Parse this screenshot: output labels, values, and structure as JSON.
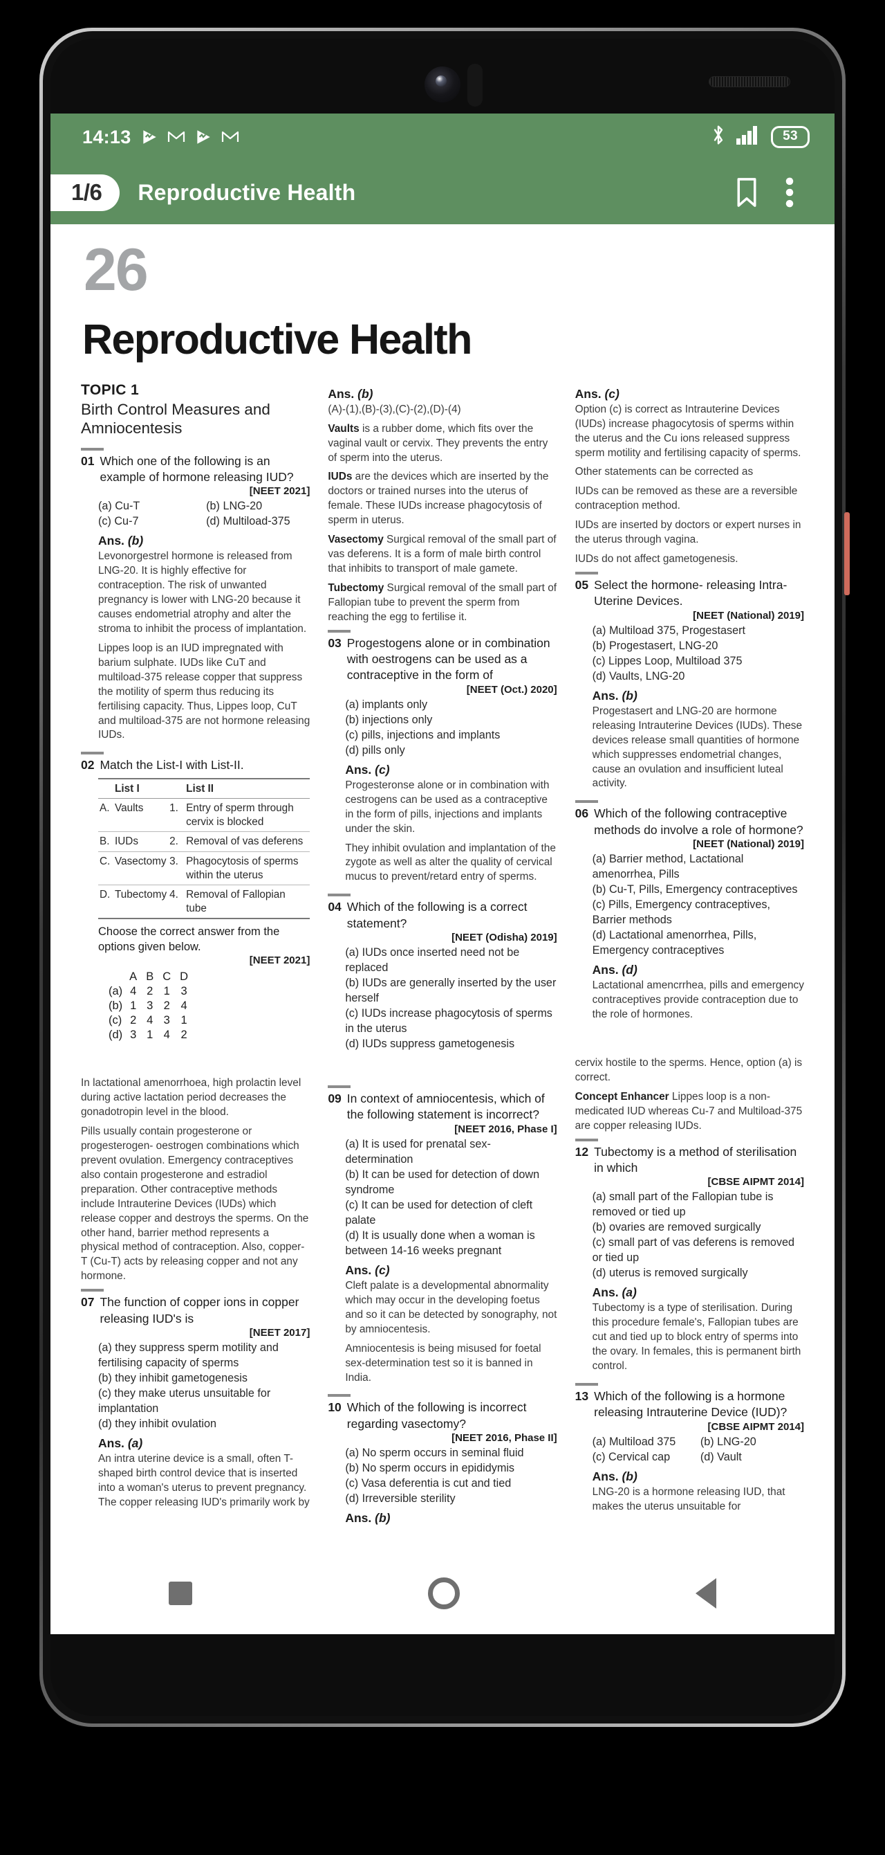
{
  "status_bar": {
    "time": "14:13",
    "icons": [
      "play-icon",
      "gmail-icon",
      "play-icon",
      "gmail-icon"
    ],
    "bluetooth": "bluetooth-icon",
    "signal": "signal-bars-icon",
    "battery_level": "53"
  },
  "app_bar": {
    "page_badge": "1/6",
    "title": "Reproductive Health",
    "bookmark": "bookmark-icon",
    "overflow": "more-vertical-icon"
  },
  "chapter": {
    "number": "26",
    "title": "Reproductive Health"
  },
  "topic": {
    "kicker": "TOPIC 1",
    "name": "Birth Control Measures and Amniocentesis"
  },
  "q1": {
    "num": "01",
    "text": "Which one of the following is an example of hormone releasing IUD?",
    "exam": "[NEET 2021]",
    "options": [
      "(a) Cu-T",
      "(b) LNG-20",
      "(c) Cu-7",
      "(d) Multiload-375"
    ],
    "ans": "Ans.",
    "ans_key": "(b)",
    "expl1": "Levonorgestrel hormone is released from LNG-20. It is highly effective for contraception. The risk of unwanted pregnancy is lower with LNG-20 because it causes endometrial atrophy and alter the stroma to inhibit the process of implantation.",
    "expl2": "Lippes loop is an IUD impregnated with barium sulphate. IUDs like CuT and multiload-375 release copper that suppress the motility of sperm thus reducing its fertilising capacity. Thus, Lippes loop, CuT and multiload-375 are not hormone releasing IUDs."
  },
  "q2": {
    "num": "02",
    "text": "Match the List-I with List-II.",
    "col1": "List I",
    "col2": "List II",
    "rows": [
      {
        "k": "A.",
        "item": "Vaults",
        "n": "1.",
        "desc": "Entry of sperm through cervix is blocked"
      },
      {
        "k": "B.",
        "item": "IUDs",
        "n": "2.",
        "desc": "Removal of vas deferens"
      },
      {
        "k": "C.",
        "item": "Vasectomy",
        "n": "3.",
        "desc": "Phagocytosis of sperms within the uterus"
      },
      {
        "k": "D.",
        "item": "Tubectomy",
        "n": "4.",
        "desc": "Removal of Fallopian tube"
      }
    ],
    "choose": "Choose the correct answer from the options given below.",
    "exam": "[NEET 2021]",
    "grid_header": [
      "A",
      "B",
      "C",
      "D"
    ],
    "grid_rows": [
      {
        "lbl": "(a)",
        "v": [
          "4",
          "2",
          "1",
          "3"
        ]
      },
      {
        "lbl": "(b)",
        "v": [
          "1",
          "3",
          "2",
          "4"
        ]
      },
      {
        "lbl": "(c)",
        "v": [
          "2",
          "4",
          "3",
          "1"
        ]
      },
      {
        "lbl": "(d)",
        "v": [
          "3",
          "1",
          "4",
          "2"
        ]
      }
    ],
    "ans": "Ans.",
    "ans_key": "(b)",
    "mapping": "(A)-(1),(B)-(3),(C)-(2),(D)-(4)",
    "e_vaults_b": "Vaults",
    "e_vaults": " is a rubber dome, which fits over the vaginal vault or cervix. They prevents the entry of sperm into the uterus.",
    "e_iud_b": "IUDs",
    "e_iud": " are the devices which are inserted by the doctors or trained nurses into the uterus of female. These IUDs increase phagocytosis of sperm in uterus.",
    "e_vas_b": "Vasectomy",
    "e_vas": " Surgical removal of the small part of vas deferens. It is a form of male birth control that inhibits to transport of male gamete.",
    "e_tub_b": "Tubectomy",
    "e_tub": " Surgical removal of the small part of Fallopian tube to prevent the sperm from reaching the egg to fertilise it."
  },
  "q3": {
    "num": "03",
    "text": "Progestogens alone or in combination with oestrogens can be used as a contraceptive in the form of",
    "exam": "[NEET (Oct.) 2020]",
    "options": [
      "(a) implants only",
      "(b) injections only",
      "(c) pills, injections and implants",
      "(d) pills only"
    ],
    "ans": "Ans.",
    "ans_key": "(c)",
    "expl1": "Progesteronse alone or in combination with cestrogens can be used as a contraceptive in the form of pills, injections and implants under the skin.",
    "expl2": "They inhibit ovulation and implantation of the zygote as well as alter the quality of cervical mucus to prevent/retard entry of sperms."
  },
  "q4": {
    "num": "04",
    "text": "Which of the following is a correct statement?",
    "exam": "[NEET (Odisha) 2019]",
    "options": [
      "(a) IUDs once inserted need not be replaced",
      "(b) IUDs are generally inserted by the user herself",
      "(c) IUDs increase phagocytosis of sperms in the uterus",
      "(d) IUDs suppress gametogenesis"
    ],
    "ans": "Ans.",
    "ans_key": "(c)",
    "expl1": "Option (c) is correct as Intrauterine Devices (IUDs) increase phagocytosis of sperms within the uterus and the Cu ions released suppress sperm motility and fertilising capacity of sperms.",
    "expl2": "Other statements can be corrected as",
    "expl3": "IUDs can be removed as these are a reversible contraception method.",
    "expl4": "IUDs are inserted by doctors or expert nurses in the uterus through vagina.",
    "expl5": "IUDs do not affect gametogenesis."
  },
  "q5": {
    "num": "05",
    "text": "Select the hormone- releasing Intra-Uterine Devices.",
    "exam": "[NEET (National) 2019]",
    "options": [
      "(a) Multiload 375, Progestasert",
      "(b) Progestasert, LNG-20",
      "(c) Lippes Loop, Multiload 375",
      "(d) Vaults, LNG-20"
    ],
    "ans": "Ans.",
    "ans_key": "(b)",
    "expl1": "Progestasert and LNG-20 are hormone releasing Intrauterine Devices (IUDs). These devices release small quantities of hormone which suppresses endometrial changes, cause an ovulation and insufficient luteal activity."
  },
  "q6": {
    "num": "06",
    "text": "Which of the following contraceptive methods do involve a role of hormone?",
    "exam": "[NEET (National) 2019]",
    "options": [
      "(a) Barrier method, Lactational amenorrhea, Pills",
      "(b) Cu-T, Pills, Emergency contraceptives",
      "(c) Pills, Emergency contraceptives, Barrier methods",
      "(d) Lactational amenorrhea, Pills, Emergency contraceptives"
    ],
    "ans": "Ans.",
    "ans_key": "(d)",
    "expl1": "Lactational amencrrhea, pills and emergency contraceptives provide contraception due to the role of hormones."
  },
  "col1_cont": {
    "expl1": "In lactational amenorrhoea, high prolactin level during active lactation period decreases the gonadotropin level in the blood.",
    "expl2": "Pills usually contain progesterone or progesterogen- oestrogen combinations which prevent ovulation. Emergency contraceptives also contain progesterone and estradiol preparation. Other contraceptive methods include Intrauterine Devices (IUDs) which release copper and destroys the sperms. On the other hand, barrier method represents a physical method of contraception. Also, copper-T (Cu-T) acts by releasing copper and not any hormone."
  },
  "q7": {
    "num": "07",
    "text": "The function of copper ions in copper releasing IUD's is",
    "exam": "[NEET 2017]",
    "options": [
      "(a) they suppress sperm motility and fertilising capacity of sperms",
      "(b) they inhibit gametogenesis",
      "(c) they make uterus unsuitable for implantation",
      "(d) they inhibit ovulation"
    ],
    "ans": "Ans.",
    "ans_key": "(a)",
    "expl1": "An intra uterine device is a small, often T-shaped birth control device that is inserted into a woman's uterus to prevent pregnancy. The copper releasing IUD's primarily work by"
  },
  "q9": {
    "num": "09",
    "text": "In context of amniocentesis, which of the following statement is incorrect?",
    "exam": "[NEET 2016, Phase I]",
    "options": [
      "(a) It is used for prenatal sex-determination",
      "(b) It can be used for detection of down syndrome",
      "(c) It can be used for detection of cleft palate",
      "(d) It is usually done when a woman is between 14-16 weeks pregnant"
    ],
    "ans": "Ans.",
    "ans_key": "(c)",
    "expl1": "Cleft palate is a developmental abnormality which may occur in the developing foetus and so it can be detected by sonography, not by amniocentesis.",
    "expl2": "Amniocentesis is being misused for foetal sex-determination test so it is banned in India."
  },
  "q10": {
    "num": "10",
    "text": "Which of the following is incorrect regarding vasectomy?",
    "exam": "[NEET 2016, Phase II]",
    "options": [
      "(a) No sperm occurs in seminal fluid",
      "(b) No sperm occurs in epididymis",
      "(c) Vasa deferentia is cut and tied",
      "(d) Irreversible sterility"
    ],
    "ans": "Ans.",
    "ans_key": "(b)"
  },
  "col3_cont": {
    "expl1": "cervix hostile to the sperms. Hence, option (a) is correct.",
    "expl2_b": "Concept Enhancer",
    "expl2": " Lippes loop is a non-medicated IUD whereas Cu-7 and Multiload-375 are copper releasing IUDs."
  },
  "q12": {
    "num": "12",
    "text": "Tubectomy is a method of sterilisation in which",
    "exam": "[CBSE AIPMT 2014]",
    "options": [
      "(a) small part of the Fallopian tube is removed or tied up",
      "(b) ovaries are removed surgically",
      "(c) small part of vas deferens is removed or tied up",
      "(d) uterus is removed surgically"
    ],
    "ans": "Ans.",
    "ans_key": "(a)",
    "expl1": "Tubectomy is a type of sterilisation. During this procedure female's, Fallopian tubes are cut and tied up to block entry of sperms into the ovary. In females, this is permanent birth control."
  },
  "q13": {
    "num": "13",
    "text": "Which of the following is a hormone releasing Intrauterine Device (IUD)?",
    "exam": "[CBSE AIPMT 2014]",
    "options": [
      "(a) Multiload 375",
      "(b) LNG-20",
      "(c) Cervical cap",
      "(d) Vault"
    ],
    "ans": "Ans.",
    "ans_key": "(b)",
    "expl1": "LNG-20 is a hormone releasing IUD, that makes the uterus unsuitable for"
  },
  "nav": {
    "back": "back-triangle-icon",
    "home": "home-circle-icon",
    "recents": "recents-square-icon"
  },
  "colors": {
    "accent": "#5e8f60",
    "chapter_number": "#a3a5a7"
  }
}
